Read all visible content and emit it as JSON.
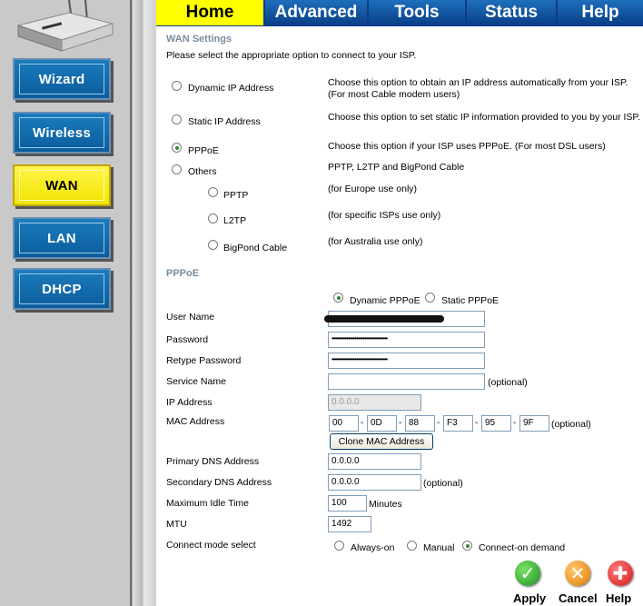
{
  "tabs": [
    {
      "label": "Home",
      "active": true
    },
    {
      "label": "Advanced",
      "active": false
    },
    {
      "label": "Tools",
      "active": false
    },
    {
      "label": "Status",
      "active": false
    },
    {
      "label": "Help",
      "active": false
    }
  ],
  "sidebar": {
    "items": [
      {
        "label": "Wizard",
        "active": false
      },
      {
        "label": "Wireless",
        "active": false
      },
      {
        "label": "WAN",
        "active": true
      },
      {
        "label": "LAN",
        "active": false
      },
      {
        "label": "DHCP",
        "active": false
      }
    ]
  },
  "wan": {
    "title": "WAN Settings",
    "intro": "Please select the appropriate option to connect to your ISP.",
    "options": {
      "dynamic": {
        "label": "Dynamic IP Address",
        "desc": "Choose this option to obtain an IP address automatically from your ISP. (For most Cable modem users)"
      },
      "static": {
        "label": "Static IP Address",
        "desc": "Choose this option to set static IP information provided to you by your ISP."
      },
      "pppoe": {
        "label": "PPPoE",
        "desc": "Choose this option if your ISP uses PPPoE. (For most DSL users)"
      },
      "others": {
        "label": "Others",
        "desc": "PPTP, L2TP and BigPond Cable"
      },
      "pptp": {
        "label": "PPTP",
        "desc": "(for Europe use only)"
      },
      "l2tp": {
        "label": "L2TP",
        "desc": "(for specific ISPs use only)"
      },
      "bigpond": {
        "label": "BigPond Cable",
        "desc": "(for Australia use only)"
      }
    },
    "selected": "pppoe"
  },
  "pppoe": {
    "title": "PPPoE",
    "mode_dynamic": "Dynamic PPPoE",
    "mode_static": "Static PPPoE",
    "labels": {
      "user_name": "User Name",
      "password": "Password",
      "retype_password": "Retype Password",
      "service_name": "Service Name",
      "ip_address": "IP Address",
      "mac_address": "MAC Address",
      "primary_dns": "Primary DNS Address",
      "secondary_dns": "Secondary DNS Address",
      "max_idle": "Maximum Idle Time",
      "mtu": "MTU",
      "connect_mode": "Connect mode select"
    },
    "values": {
      "password_mask": "••••••••••••••••••••••••••••••••••",
      "retype_mask": "••••••••••••••••••••••••••••••••••",
      "service_name": "",
      "ip_address": "0.0.0.0",
      "mac": [
        "00",
        "0D",
        "88",
        "F3",
        "95",
        "9F"
      ],
      "primary_dns": "0.0.0.0",
      "secondary_dns": "0.0.0.0",
      "max_idle": "100",
      "mtu": "1492"
    },
    "optional": "(optional)",
    "minutes": "Minutes",
    "clone_mac": "Clone MAC Address",
    "connect_modes": {
      "always_on": "Always-on",
      "manual": "Manual",
      "on_demand": "Connect-on demand"
    }
  },
  "actions": {
    "apply": "Apply",
    "cancel": "Cancel",
    "help": "Help"
  },
  "colors": {
    "accent_yellow": "#ffff00",
    "tab_blue": "#0c3c8a",
    "button_blue": "#1270b5",
    "section_gray": "#7a8ca0"
  }
}
